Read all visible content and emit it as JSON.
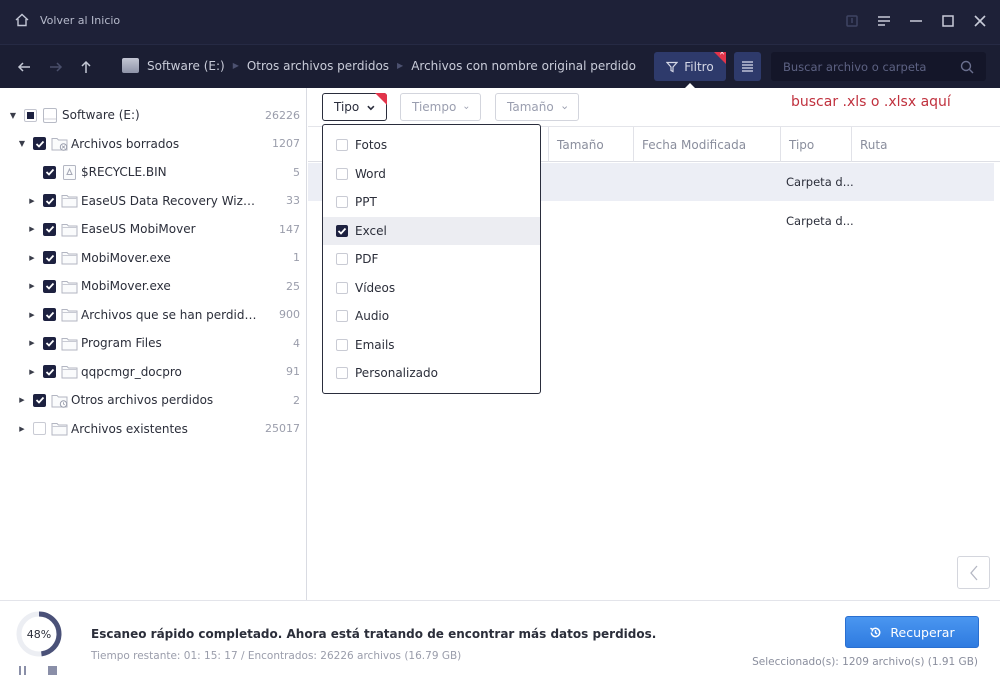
{
  "titlebar": {
    "home_label": "Volver al Inicio",
    "controls": [
      "feedback-icon",
      "menu-icon",
      "minimize-icon",
      "maximize-icon",
      "close-icon"
    ]
  },
  "navbar": {
    "breadcrumb": [
      "Software (E:)",
      "Otros archivos perdidos",
      "Archivos con nombre original perdido"
    ],
    "filter_label": "Filtro",
    "search_placeholder": "Buscar archivo o carpeta"
  },
  "tree": [
    {
      "label": "Software (E:)",
      "count": "26226",
      "level": 0,
      "expand": "expanded",
      "check": "partial",
      "icon": "drive"
    },
    {
      "label": "Archivos borrados",
      "count": "1207",
      "level": 1,
      "expand": "expanded",
      "check": "checked",
      "icon": "deleted-folder"
    },
    {
      "label": "$RECYCLE.BIN",
      "count": "5",
      "level": 2,
      "expand": "none",
      "check": "checked",
      "icon": "recycle"
    },
    {
      "label": "EaseUS Data Recovery Wizard",
      "count": "33",
      "level": 2,
      "expand": "collapsed",
      "check": "checked",
      "icon": "folder"
    },
    {
      "label": "EaseUS MobiMover",
      "count": "147",
      "level": 2,
      "expand": "collapsed",
      "check": "checked",
      "icon": "folder"
    },
    {
      "label": "MobiMover.exe",
      "count": "1",
      "level": 2,
      "expand": "collapsed",
      "check": "checked",
      "icon": "folder"
    },
    {
      "label": "MobiMover.exe",
      "count": "25",
      "level": 2,
      "expand": "collapsed",
      "check": "checked",
      "icon": "folder"
    },
    {
      "label": "Archivos que se han perdido directori...",
      "count": "900",
      "level": 2,
      "expand": "collapsed",
      "check": "checked",
      "icon": "folder"
    },
    {
      "label": "Program Files",
      "count": "4",
      "level": 2,
      "expand": "collapsed",
      "check": "checked",
      "icon": "folder"
    },
    {
      "label": "qqpcmgr_docpro",
      "count": "91",
      "level": 2,
      "expand": "collapsed",
      "check": "checked",
      "icon": "folder"
    },
    {
      "label": "Otros archivos perdidos",
      "count": "2",
      "level": 1,
      "expand": "collapsed",
      "check": "checked",
      "icon": "lost-folder"
    },
    {
      "label": "Archivos existentes",
      "count": "25017",
      "level": 1,
      "expand": "collapsed",
      "check": "empty",
      "icon": "folder"
    }
  ],
  "filters": {
    "type_label": "Tipo",
    "time_label": "Tiempo",
    "size_label": "Tamaño",
    "hint": "buscar .xls o .xlsx aquí"
  },
  "type_options": [
    {
      "label": "Fotos",
      "checked": false
    },
    {
      "label": "Word",
      "checked": false
    },
    {
      "label": "PPT",
      "checked": false
    },
    {
      "label": "Excel",
      "checked": true
    },
    {
      "label": "PDF",
      "checked": false
    },
    {
      "label": "Vídeos",
      "checked": false
    },
    {
      "label": "Audio",
      "checked": false
    },
    {
      "label": "Emails",
      "checked": false
    },
    {
      "label": "Personalizado",
      "checked": false
    }
  ],
  "table": {
    "columns": [
      "Tamaño",
      "Fecha Modificada",
      "Tipo",
      "Ruta"
    ],
    "rows": [
      {
        "type": "Carpeta d...",
        "selected": true
      },
      {
        "type": "Carpeta d...",
        "selected": false
      }
    ]
  },
  "status": {
    "progress_percent": 48,
    "progress_label": "48%",
    "message": "Escaneo rápido completado. Ahora está tratando de encontrar más datos perdidos.",
    "details": "Tiempo restante: 01: 15: 17 / Encontrados: 26226 archivos (16.79 GB)",
    "recover_label": "Recuperar",
    "selected_info": "Seleccionado(s): 1209 archivo(s) (1.91 GB)"
  },
  "colors": {
    "titlebar_bg": "#1e2138",
    "accent_blue": "#3a86ea",
    "badge_red": "#e2344a",
    "hint_red": "#c0313e"
  }
}
